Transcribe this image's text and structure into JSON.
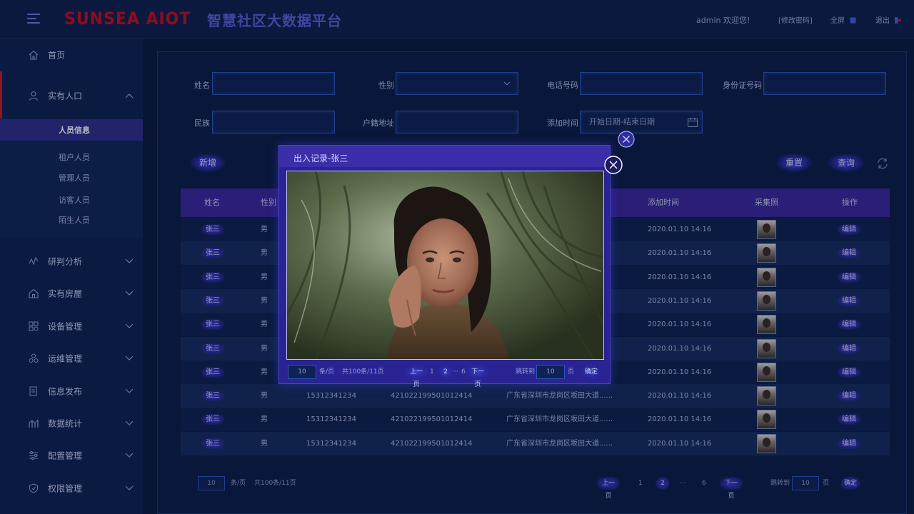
{
  "header": {
    "logo": "SUNSEA AIOT",
    "title": "智慧社区大数据平台",
    "user": "admin  欢迎您!",
    "change_password": "[修改密码]",
    "fullscreen": "全屏",
    "logout": "退出"
  },
  "sidebar": {
    "items": [
      {
        "label": "首页",
        "icon": "home-icon"
      },
      {
        "label": "实有人口",
        "icon": "user-icon"
      },
      {
        "label": "研判分析",
        "icon": "analysis-icon"
      },
      {
        "label": "实有房屋",
        "icon": "house-icon"
      },
      {
        "label": "设备管理",
        "icon": "device-icon"
      },
      {
        "label": "运维管理",
        "icon": "maintenance-icon"
      },
      {
        "label": "信息发布",
        "icon": "publish-icon"
      },
      {
        "label": "数据统计",
        "icon": "stats-icon"
      },
      {
        "label": "配置管理",
        "icon": "config-icon"
      },
      {
        "label": "权限管理",
        "icon": "permission-icon"
      }
    ],
    "sub_items": [
      "人员信息",
      "租户人员",
      "管理人员",
      "访客人员",
      "陌生人员"
    ]
  },
  "filters": {
    "name_label": "姓名",
    "gender_label": "性别",
    "phone_label": "电话号码",
    "id_label": "身份证号码",
    "ethnicity_label": "民族",
    "address_label": "户籍地址",
    "added_time_label": "添加时间",
    "date_placeholder": "开始日期-结束日期"
  },
  "actions": {
    "add": "新增",
    "reset": "重置",
    "search": "查询"
  },
  "table": {
    "headers": [
      "姓名",
      "性别",
      "添加时间",
      "采集照",
      "操作"
    ],
    "rows": [
      {
        "name": "张三",
        "gender": "男",
        "phone": "",
        "id": "",
        "address": "",
        "time": "2020.01.10 14:16",
        "action": "编辑"
      },
      {
        "name": "张三",
        "gender": "男",
        "phone": "",
        "id": "",
        "address": "",
        "time": "2020.01.10 14:16",
        "action": "编辑"
      },
      {
        "name": "张三",
        "gender": "男",
        "phone": "",
        "id": "",
        "address": "",
        "time": "2020.01.10 14:16",
        "action": "编辑"
      },
      {
        "name": "张三",
        "gender": "男",
        "phone": "",
        "id": "",
        "address": "",
        "time": "2020.01.10 14:16",
        "action": "编辑"
      },
      {
        "name": "张三",
        "gender": "男",
        "phone": "",
        "id": "",
        "address": "",
        "time": "2020.01.10 14:16",
        "action": "编辑"
      },
      {
        "name": "张三",
        "gender": "男",
        "phone": "",
        "id": "",
        "address": "",
        "time": "2020.01.10 14:16",
        "action": "编辑"
      },
      {
        "name": "张三",
        "gender": "男",
        "phone": "",
        "id": "",
        "address": "",
        "time": "2020.01.10 14:16",
        "action": "编辑"
      },
      {
        "name": "张三",
        "gender": "男",
        "phone": "15312341234",
        "id": "421022199501012414",
        "address": "广东省深圳市龙岗区坂田大道......",
        "time": "2020.01.10 14:16",
        "action": "编辑"
      },
      {
        "name": "张三",
        "gender": "男",
        "phone": "15312341234",
        "id": "421022199501012414",
        "address": "广东省深圳市龙岗区坂田大道......",
        "time": "2020.01.10 14:16",
        "action": "编辑"
      },
      {
        "name": "张三",
        "gender": "男",
        "phone": "15312341234",
        "id": "421022199501012414",
        "address": "广东省深圳市龙岗区坂田大道......",
        "time": "2020.01.10 14:16",
        "action": "编辑"
      }
    ]
  },
  "pagination": {
    "page_size": "10",
    "per_page": "条/页",
    "total": "共100条/11页",
    "prev": "上一页",
    "page1": "1",
    "page2": "2",
    "ellipsis": "···",
    "page6": "6",
    "next": "下一页",
    "goto": "跳转到",
    "goto_value": "10",
    "page_unit": "页",
    "confirm": "确定"
  },
  "modal": {
    "title": "出入记录-张三"
  },
  "colors": {
    "accent": "#3a2699",
    "brand_red": "#c40d20",
    "background": "#0d1d45"
  }
}
